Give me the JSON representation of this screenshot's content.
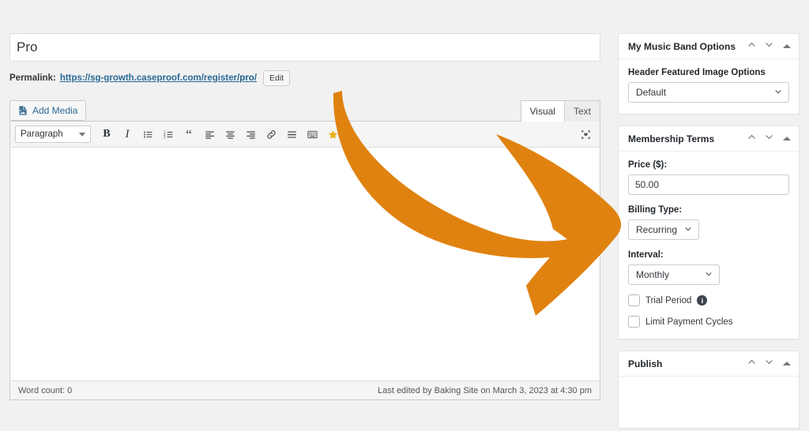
{
  "post": {
    "title_value": "Pro",
    "title_placeholder": "Add title",
    "permalink_label": "Permalink:",
    "permalink_prefix": "https://sg-growth.caseproof.com/register/",
    "permalink_slug": "pro",
    "permalink_suffix": "/",
    "edit_button": "Edit"
  },
  "editor": {
    "add_media": "Add Media",
    "tabs": [
      {
        "label": "Visual",
        "active": true
      },
      {
        "label": "Text",
        "active": false
      }
    ],
    "format_select": "Paragraph",
    "toolbar_icons": [
      "bold-icon",
      "italic-icon",
      "bulleted-list-icon",
      "numbered-list-icon",
      "blockquote-icon",
      "align-left-icon",
      "align-center-icon",
      "align-right-icon",
      "insert-link-icon",
      "read-more-icon",
      "toolbar-toggle-icon",
      "star-icon"
    ],
    "fullscreen_icon": "distraction-free-icon",
    "content": "",
    "word_count": "Word count: 0",
    "last_edited": "Last edited by Baking Site on March 3, 2023 at 4:30 pm"
  },
  "sidebar": {
    "panels": [
      {
        "title": "My Music Band Options",
        "field_label": "Header Featured Image Options",
        "select_value": "Default"
      },
      {
        "title": "Membership Terms",
        "price_label": "Price ($):",
        "price_value": "50.00",
        "billing_label": "Billing Type:",
        "billing_value": "Recurring",
        "interval_label": "Interval:",
        "interval_value": "Monthly",
        "trial_label": "Trial Period",
        "trial_checked": false,
        "limit_label": "Limit Payment Cycles",
        "limit_checked": false
      },
      {
        "title": "Publish"
      }
    ],
    "controls": {
      "move_up": "move-up",
      "move_down": "move-down",
      "collapse": "collapse"
    }
  },
  "annotation": {
    "arrow_color": "#e0820f",
    "arrow_label": "curved-arrow-pointing-right"
  },
  "theme": {
    "page_bg": "#f1f1f1",
    "link_color": "#2b6a94",
    "star_color": "#e9b11a",
    "accent": "#e0820f"
  }
}
